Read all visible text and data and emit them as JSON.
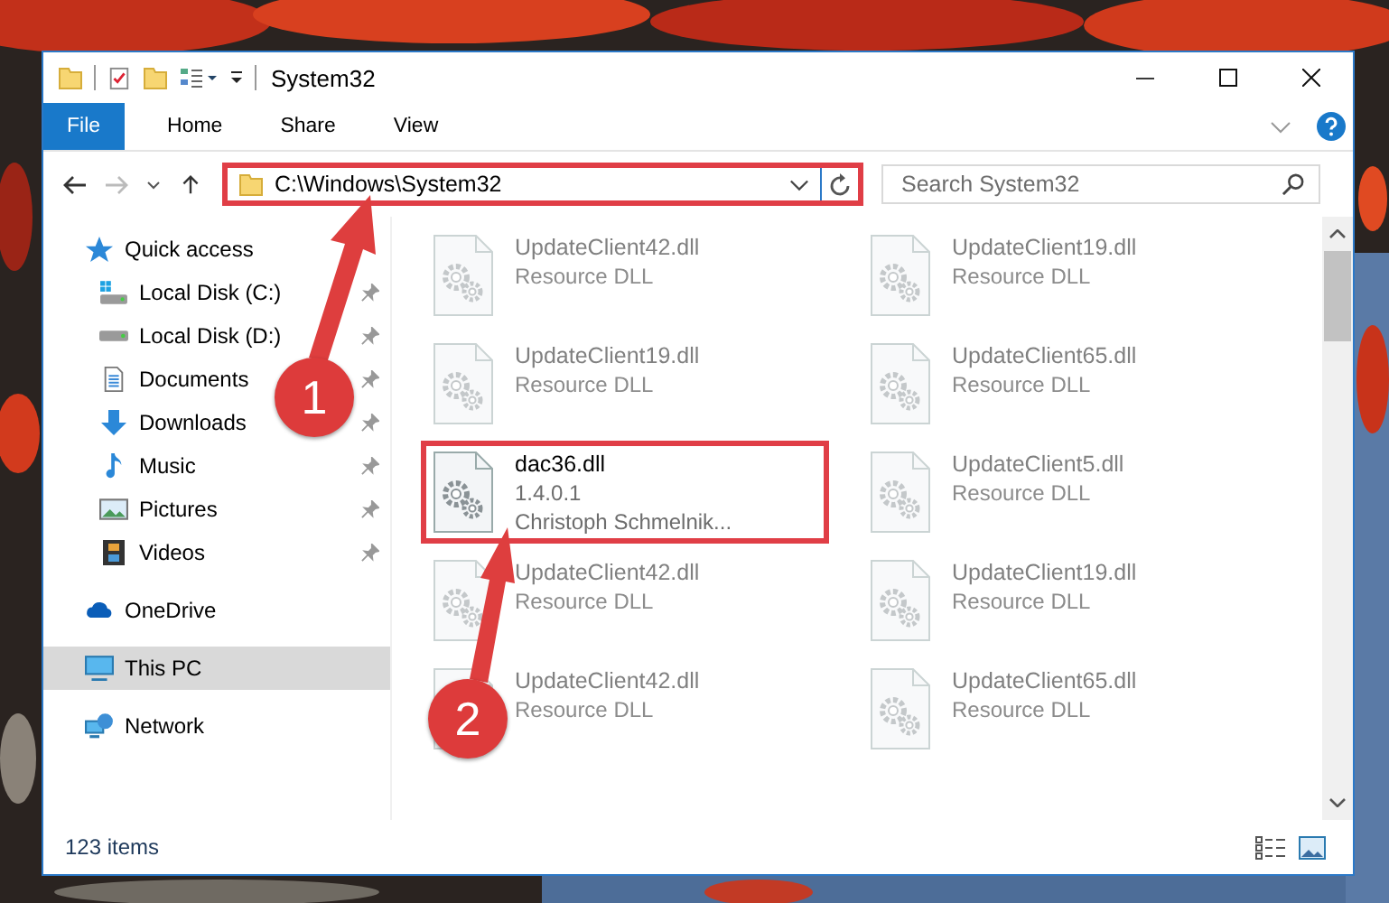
{
  "window": {
    "title": "System32"
  },
  "ribbon": {
    "tabs": [
      {
        "label": "File",
        "selected": true
      },
      {
        "label": "Home",
        "selected": false
      },
      {
        "label": "Share",
        "selected": false
      },
      {
        "label": "View",
        "selected": false
      }
    ]
  },
  "address_bar": {
    "path": "C:\\Windows\\System32",
    "highlighted": true
  },
  "search": {
    "placeholder": "Search System32"
  },
  "nav": {
    "items": [
      {
        "label": "Quick access",
        "kind": "star",
        "selected": false,
        "children": [
          {
            "label": "Local Disk (C:)",
            "kind": "system-drive",
            "selected": false,
            "pinned": true
          },
          {
            "label": "Local Disk (D:)",
            "kind": "drive",
            "selected": false,
            "pinned": true
          },
          {
            "label": "Documents",
            "kind": "documents",
            "selected": false,
            "pinned": true
          },
          {
            "label": "Downloads",
            "kind": "downloads",
            "selected": false,
            "pinned": true
          },
          {
            "label": "Music",
            "kind": "music",
            "selected": false,
            "pinned": true
          },
          {
            "label": "Pictures",
            "kind": "pictures",
            "selected": false,
            "pinned": true
          },
          {
            "label": "Videos",
            "kind": "videos",
            "selected": false,
            "pinned": true
          }
        ]
      },
      {
        "label": "OneDrive",
        "kind": "cloud",
        "selected": false
      },
      {
        "label": "This PC",
        "kind": "computer",
        "selected": true
      },
      {
        "label": "Network",
        "kind": "network",
        "selected": false
      }
    ]
  },
  "files": [
    {
      "name": "UpdateClient42.dll",
      "details": [
        "Resource DLL"
      ],
      "dimmed": true,
      "highlighted": false
    },
    {
      "name": "UpdateClient19.dll",
      "details": [
        "Resource DLL"
      ],
      "dimmed": true,
      "highlighted": false
    },
    {
      "name": "UpdateClient19.dll",
      "details": [
        "Resource DLL"
      ],
      "dimmed": true,
      "highlighted": false
    },
    {
      "name": "UpdateClient65.dll",
      "details": [
        "Resource DLL"
      ],
      "dimmed": true,
      "highlighted": false
    },
    {
      "name": "dac36.dll",
      "details": [
        "1.4.0.1",
        "Christoph Schmelnik..."
      ],
      "dimmed": false,
      "highlighted": true
    },
    {
      "name": "UpdateClient5.dll",
      "details": [
        "Resource DLL"
      ],
      "dimmed": true,
      "highlighted": false
    },
    {
      "name": "UpdateClient42.dll",
      "details": [
        "Resource DLL"
      ],
      "dimmed": true,
      "highlighted": false
    },
    {
      "name": "UpdateClient19.dll",
      "details": [
        "Resource DLL"
      ],
      "dimmed": true,
      "highlighted": false
    },
    {
      "name": "UpdateClient42.dll",
      "details": [
        "Resource DLL"
      ],
      "dimmed": true,
      "highlighted": false
    },
    {
      "name": "UpdateClient65.dll",
      "details": [
        "Resource DLL"
      ],
      "dimmed": true,
      "highlighted": false
    }
  ],
  "status_bar": {
    "item_count": "123 items"
  },
  "callouts": [
    {
      "number": "1"
    },
    {
      "number": "2"
    }
  ]
}
